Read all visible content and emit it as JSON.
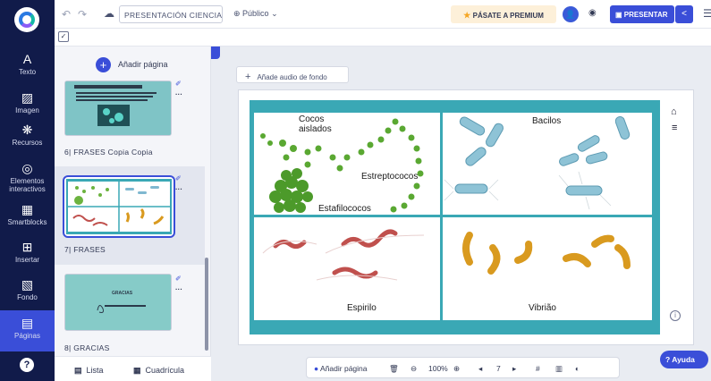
{
  "rail": {
    "items": [
      {
        "icon": "A",
        "label": "Texto"
      },
      {
        "icon": "▨",
        "label": "Imagen"
      },
      {
        "icon": "❋",
        "label": "Recursos"
      },
      {
        "icon": "◎",
        "label": "Elementos interactivos"
      },
      {
        "icon": "▦",
        "label": "Smartblocks"
      },
      {
        "icon": "⊞",
        "label": "Insertar"
      },
      {
        "icon": "▧",
        "label": "Fondo"
      },
      {
        "icon": "▤",
        "label": "Páginas"
      }
    ],
    "help_icon": "?"
  },
  "topbar": {
    "title": "PRESENTACIÓN CIENCIA...",
    "visibility": "Público",
    "premium": "PÁSATE A PREMIUM",
    "present": "PRESENTAR"
  },
  "panel": {
    "add_page": "Añadir página",
    "pages": [
      {
        "label": "6| FRASES Copia Copia"
      },
      {
        "label": "7| FRASES"
      },
      {
        "label": "8| GRACIAS"
      }
    ],
    "thumb8_title": "GRACIAS",
    "tabs": {
      "list": "Lista",
      "grid": "Cuadrícula"
    }
  },
  "canvas": {
    "audio_button": "Añade audio de fondo",
    "quadrants": {
      "cocos": {
        "labels": [
          "Cocos",
          "aislados",
          "Estreptococos",
          "Estafilococos"
        ]
      },
      "bacilos": {
        "labels": [
          "Bacilos"
        ]
      },
      "espirilo": {
        "labels": [
          "Espirilo"
        ]
      },
      "vibrion": {
        "labels": [
          "Vibrião"
        ]
      }
    }
  },
  "bottombar": {
    "add_page": "Añadir página",
    "zoom": "100%",
    "page": "7"
  },
  "help": "Ayuda",
  "colors": {
    "rail": "#111b4a",
    "accent": "#3a4ed8",
    "slide_teal": "#3aa8b5",
    "premium_bg": "#fdf0d9"
  }
}
